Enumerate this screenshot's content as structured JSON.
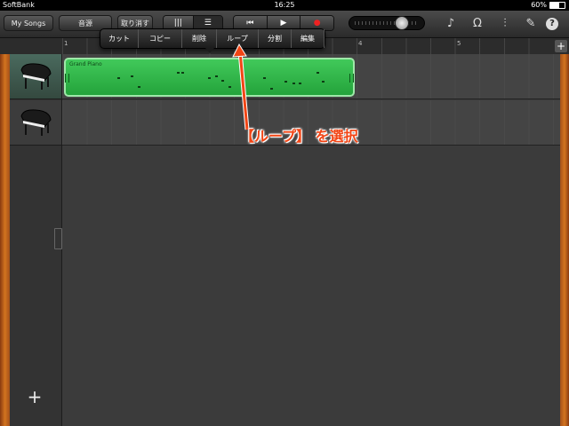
{
  "status_bar": {
    "carrier": "SoftBank",
    "time": "16:25",
    "battery": "60%"
  },
  "toolbar": {
    "my_songs": "My Songs",
    "instrument": "音源",
    "undo": "取り消す",
    "view_modes": [
      "|||",
      "☰"
    ],
    "transport": [
      "⏮",
      "▶",
      "●"
    ],
    "icons": [
      "metronome-icon",
      "loop-browser-icon",
      "mixer-icon",
      "settings-icon",
      "help-icon"
    ],
    "help_label": "?"
  },
  "popup_menu": {
    "items": [
      "カット",
      "コピー",
      "削除",
      "ループ",
      "分割",
      "編集"
    ]
  },
  "ruler": {
    "markers": [
      "1",
      "4",
      "5"
    ],
    "add_label": "+"
  },
  "tracks": [
    {
      "instrument": "grand-piano-icon",
      "region": {
        "name": "Grand Piano"
      }
    },
    {
      "instrument": "grand-piano-icon"
    }
  ],
  "add_track_label": "+",
  "annotation": {
    "text": "【ループ】 を選択",
    "color": "#f24515"
  },
  "colors": {
    "region_green": "#2fb847",
    "wood": "#d3741f",
    "annotation": "#f24515"
  }
}
